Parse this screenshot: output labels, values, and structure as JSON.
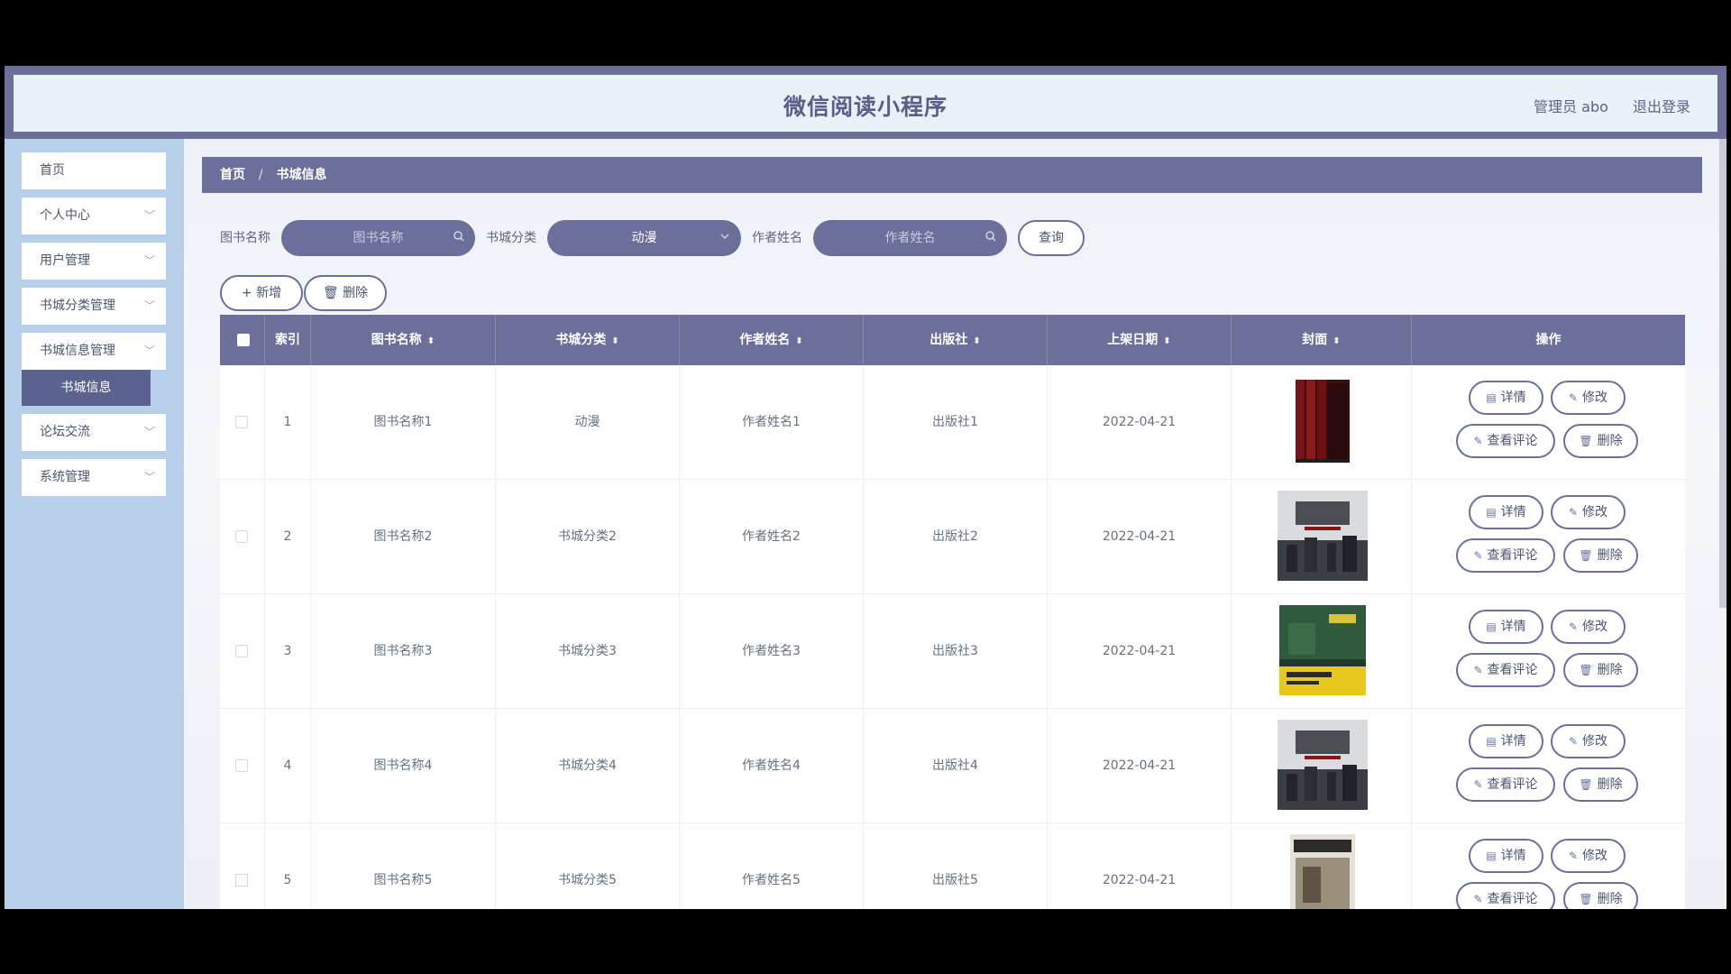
{
  "app": {
    "title": "微信阅读小程序",
    "admin_label": "管理员 abo",
    "logout_label": "退出登录"
  },
  "sidebar": {
    "items": [
      {
        "label": "首页",
        "chevron": ""
      },
      {
        "label": "个人中心",
        "chevron": "﹀"
      },
      {
        "label": "用户管理",
        "chevron": "﹀"
      },
      {
        "label": "书城分类管理",
        "chevron": "﹀"
      },
      {
        "label": "书城信息管理",
        "chevron": "﹀"
      },
      {
        "label": "论坛交流",
        "chevron": "﹀"
      },
      {
        "label": "系统管理",
        "chevron": "﹀"
      }
    ],
    "active_sub": "书城信息"
  },
  "breadcrumb": {
    "home": "首页",
    "sep": "/",
    "current": "书城信息"
  },
  "search": {
    "book_name_label": "图书名称",
    "book_name_placeholder": "图书名称",
    "category_label": "书城分类",
    "category_value": "动漫",
    "author_label": "作者姓名",
    "author_placeholder": "作者姓名",
    "query_label": "查询",
    "search_icon": "search-icon",
    "dropdown_icon": "chevron-down-icon"
  },
  "toolbar": {
    "add_label": "+ 新增",
    "delete_label": "🗑 删除"
  },
  "table": {
    "headers": [
      "索引",
      "图书名称",
      "书城分类",
      "作者姓名",
      "出版社",
      "上架日期",
      "封面",
      "操作"
    ],
    "sort_glyph": "⬍",
    "actions": {
      "detail": "详情",
      "edit": "修改",
      "comments": "查看评论",
      "delete": "删除"
    },
    "rows": [
      {
        "index": "1",
        "name": "图书名称1",
        "category": "动漫",
        "author": "作者姓名1",
        "publisher": "出版社1",
        "date": "2022-04-21"
      },
      {
        "index": "2",
        "name": "图书名称2",
        "category": "书城分类2",
        "author": "作者姓名2",
        "publisher": "出版社2",
        "date": "2022-04-21"
      },
      {
        "index": "3",
        "name": "图书名称3",
        "category": "书城分类3",
        "author": "作者姓名3",
        "publisher": "出版社3",
        "date": "2022-04-21"
      },
      {
        "index": "4",
        "name": "图书名称4",
        "category": "书城分类4",
        "author": "作者姓名4",
        "publisher": "出版社4",
        "date": "2022-04-21"
      },
      {
        "index": "5",
        "name": "图书名称5",
        "category": "书城分类5",
        "author": "作者姓名5",
        "publisher": "出版社5",
        "date": "2022-04-21"
      }
    ]
  },
  "colors": {
    "accent": "#6b6f9a",
    "sidebar": "#b7cfe8",
    "header_bg": "#e8f2fb"
  }
}
